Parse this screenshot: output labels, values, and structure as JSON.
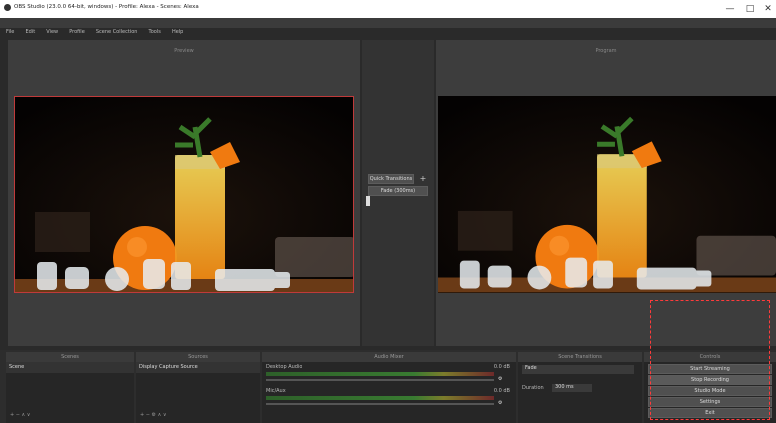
{
  "window": {
    "title": "OBS Studio (23.0.0 64-bit, windows) - Profile: Alexa - Scenes: Alexa",
    "minimize": "—",
    "maximize": "□",
    "close": "✕"
  },
  "menu": [
    "File",
    "Edit",
    "View",
    "Profile",
    "Scene Collection",
    "Tools",
    "Help"
  ],
  "preview": {
    "studio_label": "Preview",
    "program_label": "Program"
  },
  "transition": {
    "quick_label": "Quick Transitions",
    "add_icon": "+",
    "fade_label": "Fade (300ms)"
  },
  "docks": {
    "scenes": {
      "title": "Scenes",
      "items": [
        "Scene"
      ]
    },
    "sources": {
      "title": "Sources",
      "items": [
        "Display Capture Source"
      ]
    },
    "mixer": {
      "title": "Audio Mixer",
      "tracks": [
        {
          "name": "Desktop Audio",
          "level": "0.0 dB"
        },
        {
          "name": "Mic/Aux",
          "level": "0.0 dB"
        }
      ]
    },
    "transitions": {
      "title": "Scene Transitions",
      "selected": "Fade",
      "duration_label": "Duration",
      "duration_value": "300 ms"
    },
    "controls": {
      "title": "Controls",
      "buttons": [
        "Start Streaming",
        "Stop Recording",
        "Studio Mode",
        "Settings",
        "Exit"
      ]
    }
  },
  "colors": {
    "accent_red": "#ff3b3b",
    "panel": "#3d3d3d",
    "bg": "#2a2a2a"
  }
}
